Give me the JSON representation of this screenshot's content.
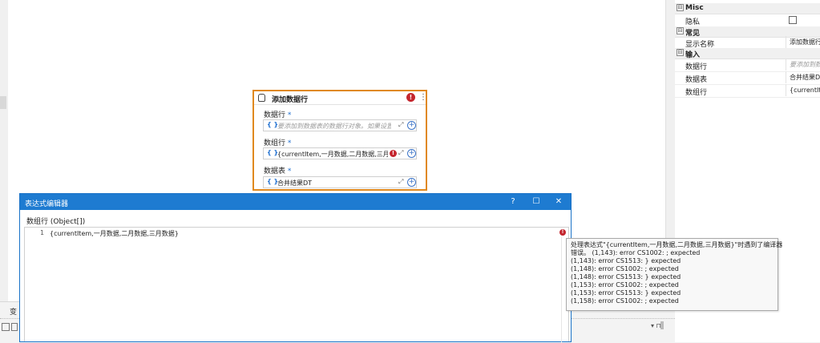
{
  "properties": {
    "categories": [
      {
        "name": "Misc",
        "toggle": "⊟",
        "rows": [
          {
            "label": "隐私",
            "type": "checkbox",
            "value": ""
          }
        ]
      },
      {
        "name": "常见",
        "toggle": "⊟",
        "rows": [
          {
            "label": "显示名称",
            "type": "text",
            "value": "添加数据行"
          }
        ]
      },
      {
        "name": "输入",
        "toggle": "⊟",
        "rows": [
          {
            "label": "数据行",
            "type": "placeholder",
            "value": "要添加到数"
          },
          {
            "label": "数据表",
            "type": "text",
            "value": "合并结果DT"
          },
          {
            "label": "数组行",
            "type": "text",
            "value": "{currentItem"
          }
        ]
      }
    ]
  },
  "activity": {
    "title": "添加数据行",
    "error_glyph": "!",
    "more_glyph": "⋮",
    "fields": [
      {
        "label": "数据行",
        "required": "*",
        "value": "要添加到数据表的数据行对象。如果设置了",
        "placeholder": true,
        "error": false
      },
      {
        "label": "数组行",
        "required": "*",
        "value": "{currentItem,一月数据,二月数据,三月数据}",
        "placeholder": false,
        "error": true
      },
      {
        "label": "数据表",
        "required": "*",
        "value": "合并结果DT",
        "placeholder": false,
        "error": false
      }
    ],
    "brace_glyph": "{ }",
    "expand_glyph": "⤢",
    "plus_glyph": "+"
  },
  "bottom_panel": {
    "tab_label": "变",
    "pin_glyph": "▾ ⊓"
  },
  "editor_dialog": {
    "title": "表达式编辑器",
    "help_glyph": "?",
    "maximize_glyph": "☐",
    "close_glyph": "✕",
    "field_type_label": "数组行 (Object[])",
    "line_number": "1",
    "code": "{currentItem,一月数据,二月数据,三月数据}"
  },
  "tooltip": {
    "lines": [
      "处理表达式\"{currentItem,一月数据,二月数据,三月数据}\"时遇到了编译器",
      "错误。 (1,143): error CS1002: ; expected",
      "(1,143): error CS1513: } expected",
      "(1,148): error CS1002: ; expected",
      "(1,148): error CS1513: } expected",
      "(1,153): error CS1002: ; expected",
      "(1,153): error CS1513: } expected",
      "(1,158): error CS1002: ; expected"
    ]
  },
  "colors": {
    "accent": "#1e7bd1",
    "card_border": "#e0891e",
    "error": "#c4262e"
  }
}
